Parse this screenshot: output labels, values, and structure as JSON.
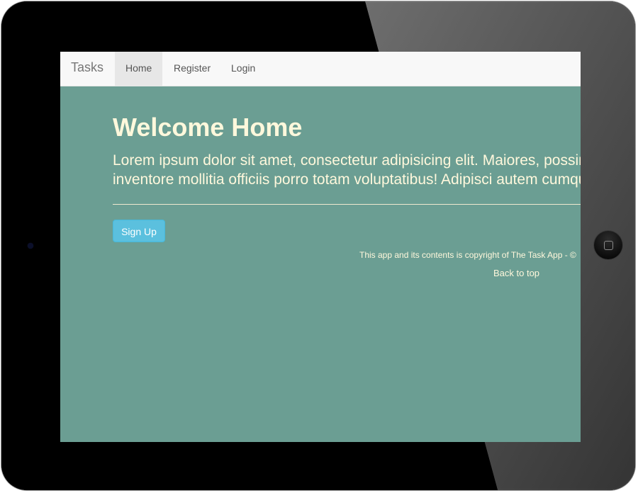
{
  "navbar": {
    "brand": "Tasks",
    "items": [
      {
        "label": "Home",
        "active": true
      },
      {
        "label": "Register",
        "active": false
      },
      {
        "label": "Login",
        "active": false
      }
    ]
  },
  "main": {
    "heading": "Welcome Home",
    "lead_line1": "Lorem ipsum dolor sit amet, consectetur adipisicing elit. Maiores, possimu",
    "lead_line2": "inventore mollitia officiis porro totam voluptatibus! Adipisci autem cumque",
    "signup_label": "Sign Up"
  },
  "footer": {
    "copyright": "This app and its contents is copyright of The Task App - ©",
    "back_to_top": "Back to top"
  },
  "colors": {
    "page_background": "#6b9e93",
    "text": "#fff8dc",
    "navbar_background": "#f8f8f8",
    "active_nav": "#e7e7e7",
    "button": "#5bc0de"
  },
  "icons": {
    "device_home_button": "home-button-icon",
    "device_camera": "camera-icon"
  }
}
